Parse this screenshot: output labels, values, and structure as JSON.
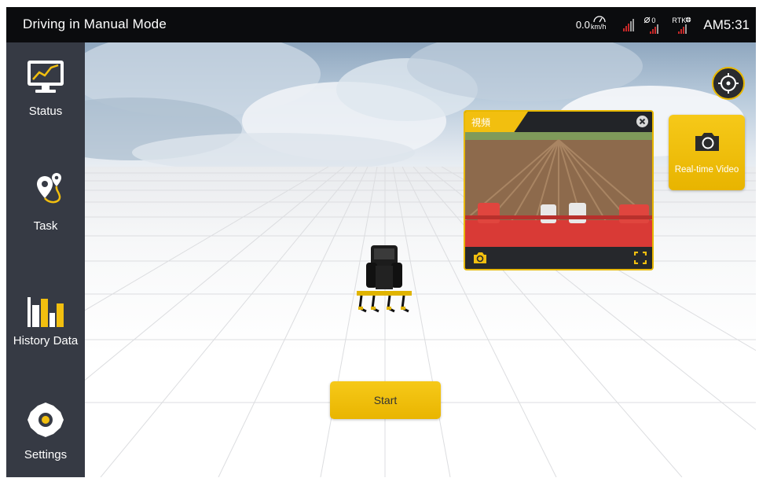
{
  "topbar": {
    "title": "Driving in Manual Mode",
    "speed_value": "0.0",
    "speed_unit": "km/h",
    "satellite_count": "0",
    "rtk_label": "RTK",
    "clock": "AM5:31"
  },
  "sidebar": {
    "items": [
      {
        "label": "Status",
        "icon": "monitor-chart-icon"
      },
      {
        "label": "Task",
        "icon": "route-pin-icon"
      },
      {
        "label": "History Data",
        "icon": "bar-chart-icon"
      },
      {
        "label": "Settings",
        "icon": "gear-icon"
      }
    ]
  },
  "video_popup": {
    "title": "視頻",
    "icons": [
      "close-icon",
      "camera-switch-icon",
      "fullscreen-icon"
    ]
  },
  "realtime_video": {
    "label": "Real-time Video",
    "icon": "camera-icon"
  },
  "locate": {
    "icon": "crosshair-icon"
  },
  "start_button": {
    "label": "Start"
  },
  "colors": {
    "accent": "#f2bf0f",
    "sidebar_bg": "#363a44",
    "topbar_bg": "#0b0c0e",
    "signal_red": "#c62828"
  }
}
